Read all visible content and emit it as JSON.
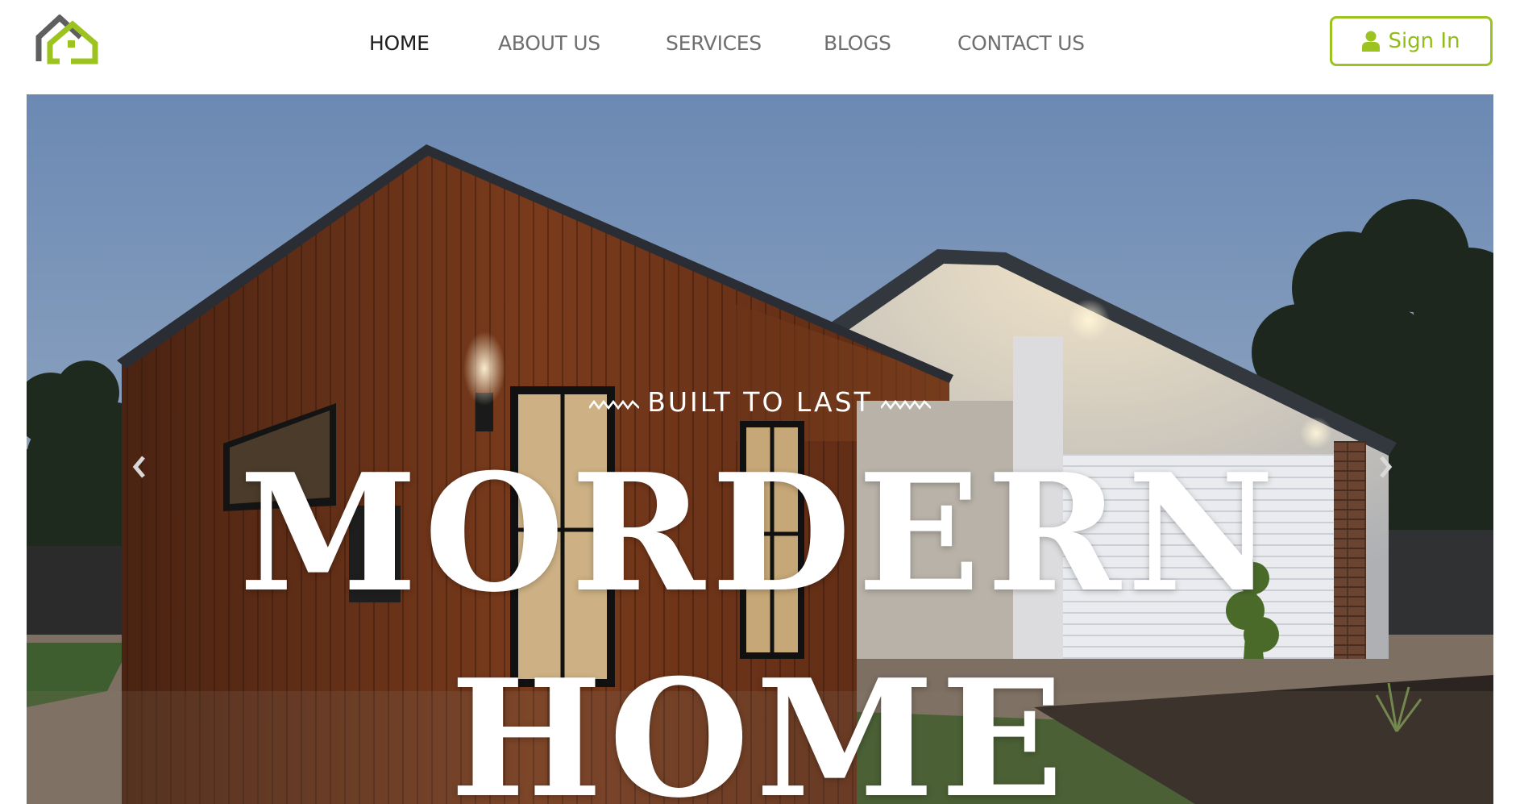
{
  "nav": {
    "items": [
      {
        "label": "HOME",
        "active": true
      },
      {
        "label": "ABOUT US",
        "active": false
      },
      {
        "label": "SERVICES",
        "active": false
      },
      {
        "label": "BLOGS",
        "active": false
      },
      {
        "label": "CONTACT US",
        "active": false
      }
    ],
    "signin_label": "Sign In"
  },
  "hero": {
    "tagline": "BUILT TO LAST",
    "title_line1": "MORDERN",
    "title_line2": "HOME"
  },
  "icons": {
    "logo": "house-logo-icon",
    "signin": "user-icon",
    "prev": "chevron-left-icon",
    "next": "chevron-right-icon"
  },
  "colors": {
    "accent": "#9cc31f",
    "nav_text": "#6f6f6f",
    "nav_active": "#1f1f1f",
    "hero_text": "#ffffff"
  }
}
